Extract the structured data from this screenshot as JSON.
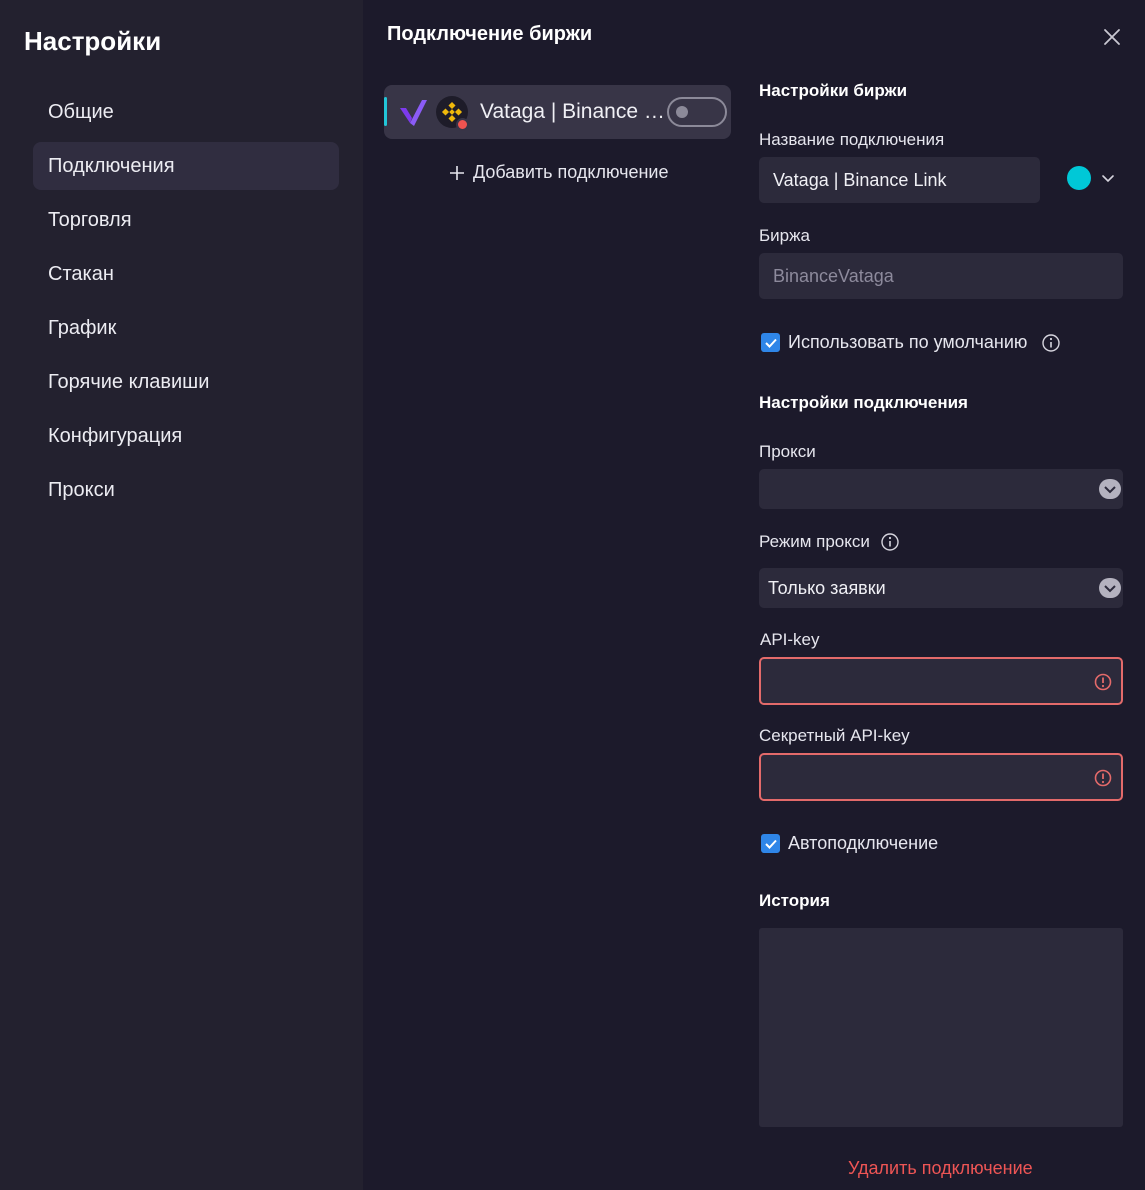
{
  "sidebar": {
    "title": "Настройки",
    "items": [
      {
        "label": "Общие"
      },
      {
        "label": "Подключения"
      },
      {
        "label": "Торговля"
      },
      {
        "label": "Стакан"
      },
      {
        "label": "График"
      },
      {
        "label": "Горячие клавиши"
      },
      {
        "label": "Конфигурация"
      },
      {
        "label": "Прокси"
      }
    ],
    "active_index": 1
  },
  "main": {
    "title": "Подключение биржи",
    "close_icon": "close-icon"
  },
  "connections": {
    "items": [
      {
        "name": "Vataga | Binance L...",
        "enabled": false,
        "indicator_color": "#22c6d8",
        "status_color": "#ef5350"
      }
    ],
    "add_label": "Добавить подключение"
  },
  "form": {
    "exchange_section": "Настройки биржи",
    "connection_name_label": "Название подключения",
    "connection_name_value": "Vataga | Binance Link",
    "color": "#00c8d7",
    "exchange_label": "Биржа",
    "exchange_value": "BinanceVataga",
    "use_default_label": "Использовать по умолчанию",
    "use_default_checked": true,
    "connection_section": "Настройки подключения",
    "proxy_label": "Прокси",
    "proxy_value": "",
    "proxy_mode_label": "Режим прокси",
    "proxy_mode_value": "Только заявки",
    "api_key_label": "API-key",
    "api_key_value": "",
    "secret_key_label": "Секретный API-key",
    "secret_key_value": "",
    "autoconnect_label": "Автоподключение",
    "autoconnect_checked": true,
    "history_section": "История",
    "delete_label": "Удалить подключение"
  },
  "colors": {
    "accent": "#2f86e8",
    "error": "#e36a6a",
    "danger_text": "#ee5555"
  }
}
